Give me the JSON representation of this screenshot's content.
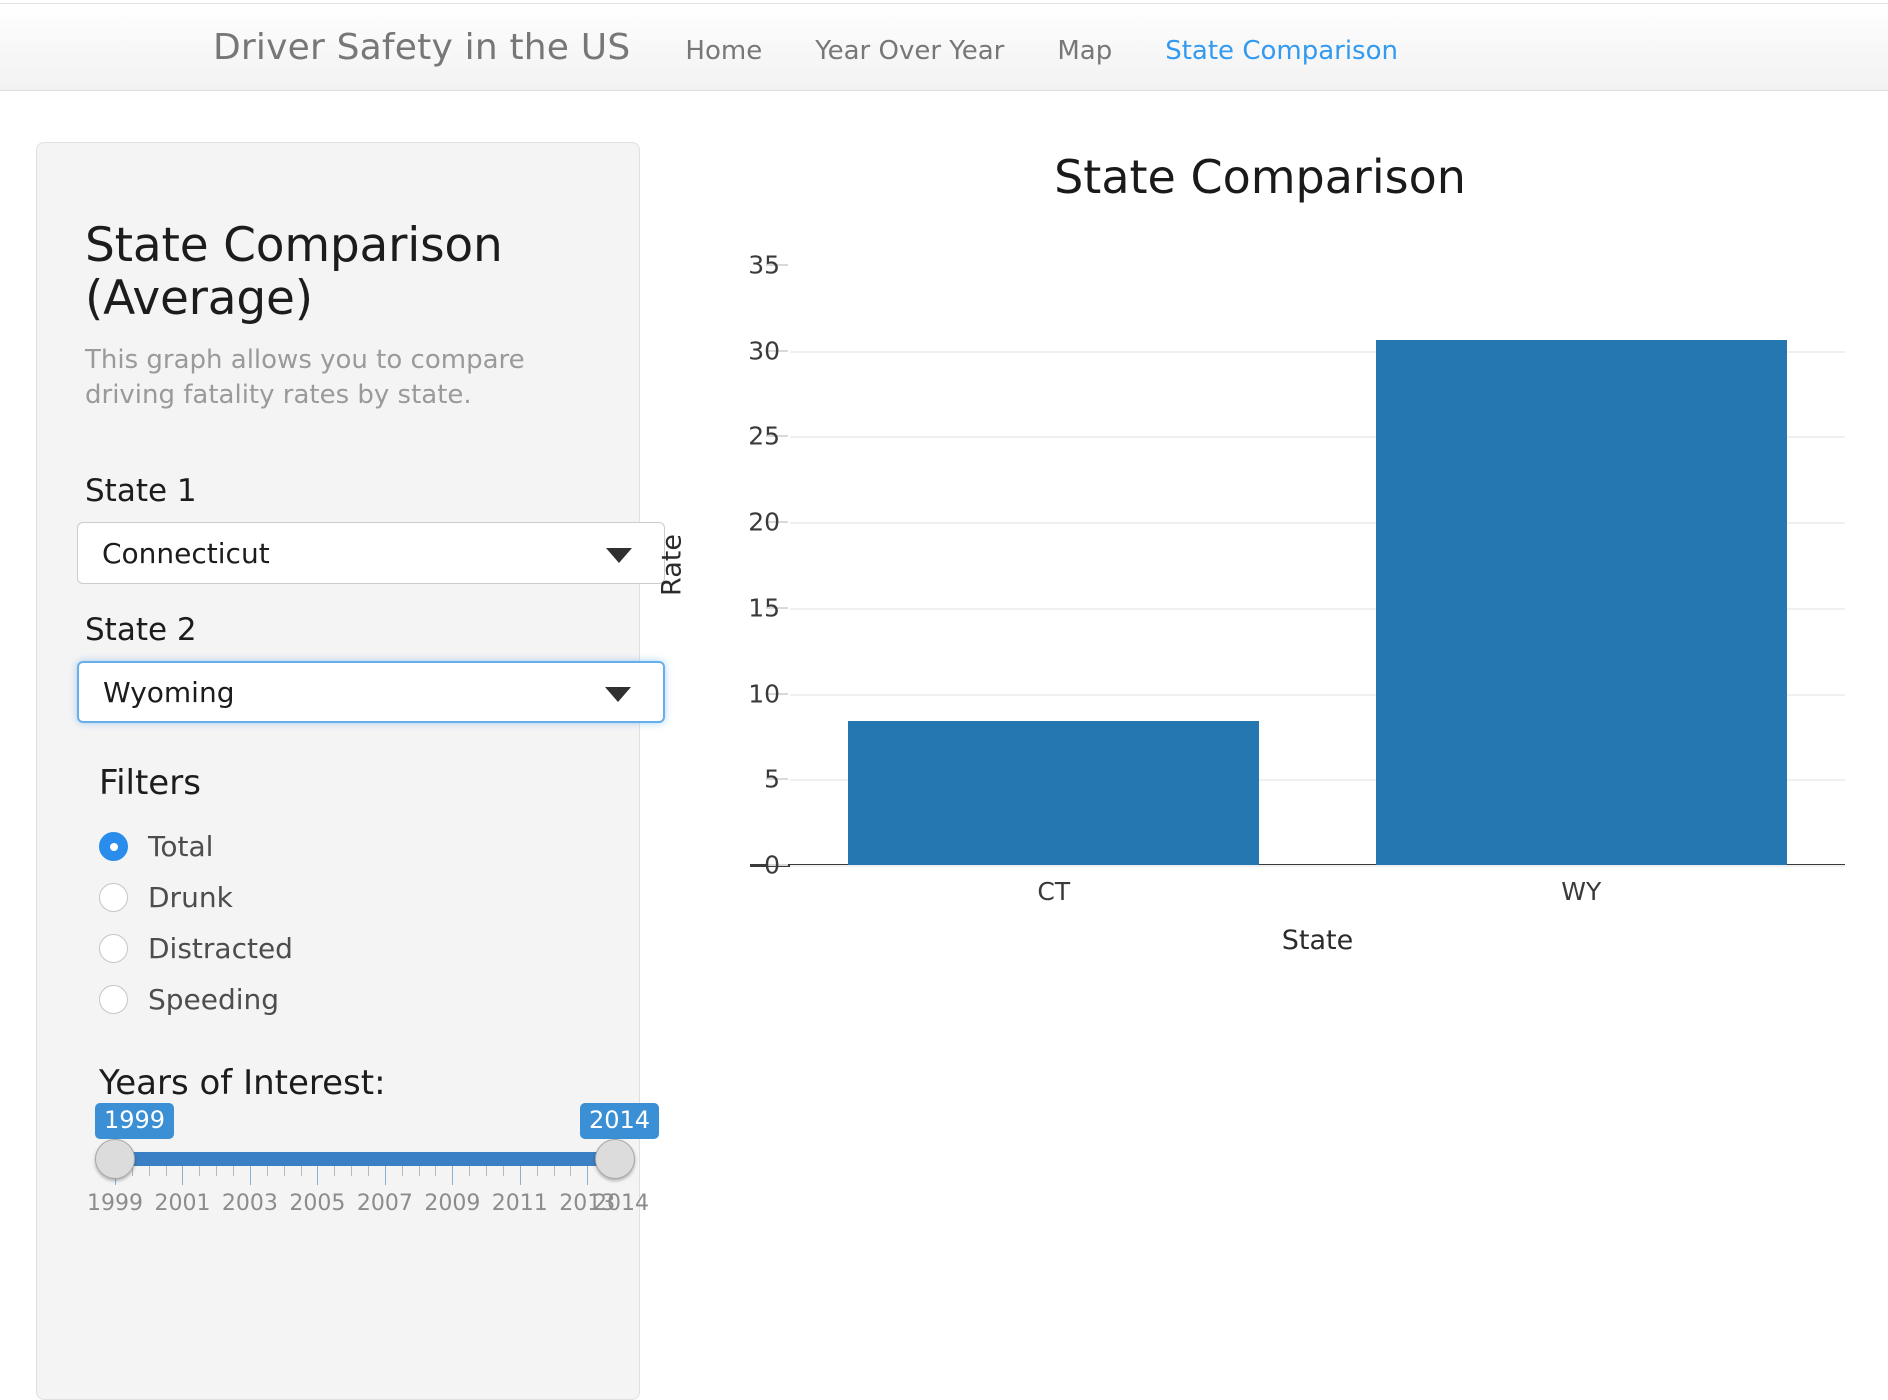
{
  "navbar": {
    "brand": "Driver Safety in the US",
    "links": [
      {
        "label": "Home",
        "active": false
      },
      {
        "label": "Year Over Year",
        "active": false
      },
      {
        "label": "Map",
        "active": false
      },
      {
        "label": "State Comparison",
        "active": true
      }
    ],
    "active_color": "#339af0",
    "text_color": "#777777"
  },
  "sidebar": {
    "title": "State Comparison (Average)",
    "description": "This graph allows you to compare driving fatality rates by state.",
    "state1": {
      "label": "State 1",
      "value": "Connecticut",
      "focused": false
    },
    "state2": {
      "label": "State 2",
      "value": "Wyoming",
      "focused": true
    },
    "filters": {
      "heading": "Filters",
      "options": [
        {
          "label": "Total",
          "selected": true
        },
        {
          "label": "Drunk",
          "selected": false
        },
        {
          "label": "Distracted",
          "selected": false
        },
        {
          "label": "Speeding",
          "selected": false
        }
      ],
      "selected_color": "#2a8ceb"
    },
    "years": {
      "heading": "Years of Interest:",
      "min": 1999,
      "max": 2014,
      "value_low": 1999,
      "value_high": 2014,
      "bubble_low": "1999",
      "bubble_high": "2014",
      "tick_labels": [
        "1999",
        "2001",
        "2003",
        "2005",
        "2007",
        "2009",
        "2011",
        "2013",
        "2014"
      ],
      "tick_values": [
        1999,
        2001,
        2003,
        2005,
        2007,
        2009,
        2011,
        2013,
        2014
      ],
      "fill_color": "#3b7fc4"
    }
  },
  "chart_data": {
    "type": "bar",
    "title": "State Comparison",
    "xlabel": "State",
    "ylabel": "Rate",
    "categories": [
      "CT",
      "WY"
    ],
    "values": [
      8.4,
      30.6
    ],
    "ylim": [
      0,
      35
    ],
    "yticks": [
      0,
      5,
      10,
      15,
      20,
      25,
      30,
      35
    ],
    "ytick_labels": [
      "0",
      "5",
      "10",
      "15",
      "20",
      "25",
      "30",
      "35"
    ],
    "grid": true,
    "legend": null,
    "bar_color": "#2577b1"
  }
}
